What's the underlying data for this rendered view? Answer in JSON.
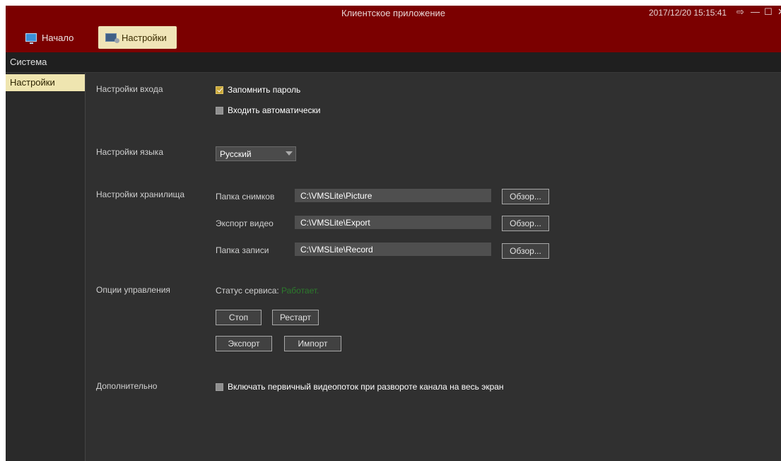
{
  "window": {
    "title": "Клиентское приложение",
    "datetime": "2017/12/20 15:15:41",
    "icons": [
      "logout-icon",
      "minimize-icon",
      "maximize-icon",
      "close-icon"
    ]
  },
  "main_tabs": [
    {
      "label": "Начало",
      "icon": "monitor-icon",
      "active": false
    },
    {
      "label": "Настройки",
      "icon": "settings-icon",
      "active": true
    }
  ],
  "section_header": "Система",
  "sidebar": {
    "items": [
      {
        "label": "Настройки",
        "active": true
      }
    ]
  },
  "login_settings": {
    "label": "Настройки входа",
    "remember_password": {
      "label": "Запомнить пароль",
      "checked": true
    },
    "auto_login": {
      "label": "Входить автоматически",
      "checked": false
    }
  },
  "language_settings": {
    "label": "Настройки языка",
    "selected": "Русский"
  },
  "storage_settings": {
    "label": "Настройки хранилища",
    "rows": [
      {
        "label": "Папка снимков",
        "value": "C:\\VMSLite\\Picture",
        "button": "Обзор..."
      },
      {
        "label": "Экспорт видео",
        "value": "C:\\VMSLite\\Export",
        "button": "Обзор..."
      },
      {
        "label": "Папка записи",
        "value": "C:\\VMSLite\\Record",
        "button": "Обзор..."
      }
    ]
  },
  "control_options": {
    "label": "Опции управления",
    "service_status_label": "Статус сервиса:",
    "service_status_value": "Работает.",
    "status_color": "#2c7a2c",
    "stop_button": "Стоп",
    "restart_button": "Рестарт",
    "export_button": "Экспорт",
    "import_button": "Импорт"
  },
  "additional": {
    "label": "Дополнительно",
    "primary_stream": {
      "label": "Включать первичный видеопоток при развороте канала на весь экран",
      "checked": false
    }
  },
  "colors": {
    "titlebar": "#7b0000",
    "active_tab": "#f0e5b8",
    "background": "#303030",
    "checkbox_checked": "#c8a638"
  }
}
